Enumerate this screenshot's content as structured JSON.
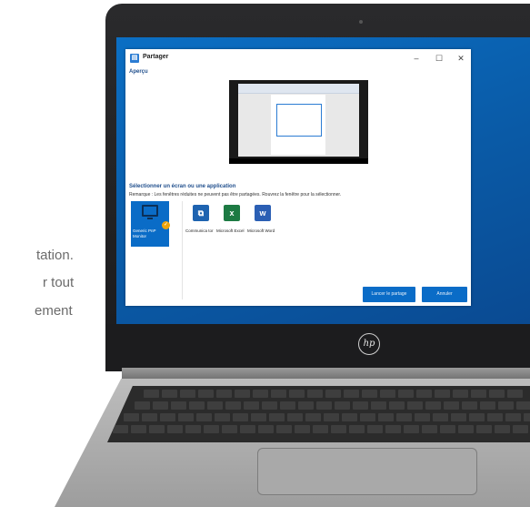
{
  "background_text": {
    "line1": "tation.",
    "line2": "r tout",
    "line3": "ement"
  },
  "window": {
    "title": "Partager",
    "controls": {
      "minimize": "–",
      "maximize": "☐",
      "close": "✕"
    },
    "preview_heading": "Aperçu",
    "select_heading": "Sélectionner un écran ou une application",
    "instruction": "Remarque : Les fenêtres réduites ne peuvent pas être partagées. Rouvrez la fenêtre pour la sélectionner.",
    "tiles": [
      {
        "label": "Generic PnP Monitor",
        "icon": "monitor-icon",
        "selected": true
      },
      {
        "label": "Communica tor",
        "icon": "communicator-icon",
        "color": "#1e63b0"
      },
      {
        "label": "Microsoft Excel",
        "icon": "excel-icon",
        "color": "#1d7a43"
      },
      {
        "label": "Microsoft Word",
        "icon": "word-icon",
        "color": "#2b5fb4"
      }
    ],
    "buttons": {
      "share": "Lancer le partage",
      "cancel": "Annuler"
    }
  },
  "device": {
    "logo": "hp"
  },
  "colors": {
    "accent": "#0a6cc7",
    "desktop": "#0b6fc4",
    "badge": "#f0a40a"
  }
}
